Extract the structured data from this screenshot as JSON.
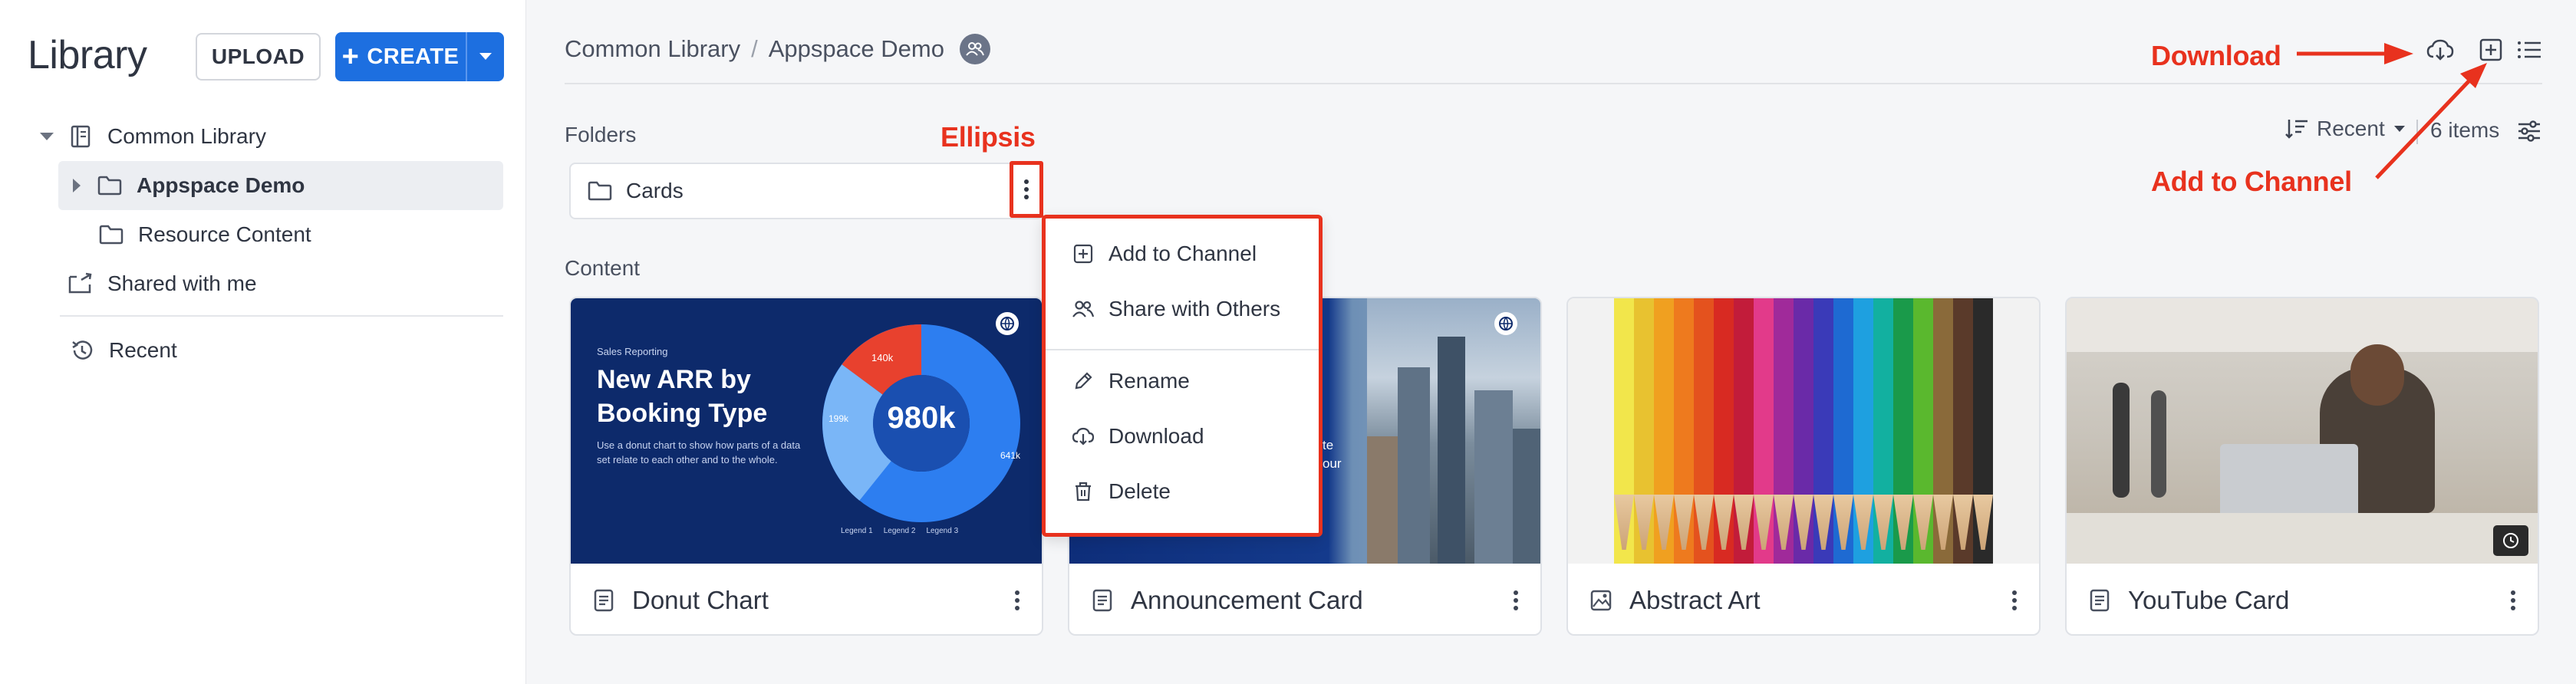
{
  "sidebar": {
    "title": "Library",
    "upload_label": "UPLOAD",
    "create_label": "CREATE",
    "tree": [
      {
        "label": "Common Library"
      },
      {
        "label": "Appspace Demo"
      },
      {
        "label": "Resource Content"
      },
      {
        "label": "Shared with me"
      },
      {
        "label": "Recent"
      }
    ]
  },
  "header": {
    "breadcrumb": [
      "Common Library",
      "/",
      "Appspace Demo"
    ]
  },
  "toolbar": {
    "sort_label": "Recent",
    "items_count": "6 items",
    "icons": [
      "download-icon",
      "add-to-channel-icon",
      "list-view-icon",
      "filter-settings-icon"
    ]
  },
  "folders": {
    "label": "Folders",
    "items": [
      {
        "name": "Cards"
      }
    ]
  },
  "context_menu": {
    "items": [
      {
        "label": "Add to Channel",
        "icon": "add-box-icon"
      },
      {
        "label": "Share with Others",
        "icon": "people-icon"
      },
      {
        "label": "Rename",
        "icon": "pencil-icon"
      },
      {
        "label": "Download",
        "icon": "cloud-download-icon"
      },
      {
        "label": "Delete",
        "icon": "trash-icon"
      }
    ]
  },
  "content": {
    "label": "Content",
    "cards": [
      {
        "title": "Donut Chart",
        "thumb": {
          "kicker": "Sales Reporting",
          "heading_line1": "New ARR by",
          "heading_line2": "Booking Type",
          "body": "Use a donut chart to show how parts of a data set relate to each other and to the whole.",
          "center_value": "980k",
          "slice_labels": [
            "140k",
            "199k",
            "641k"
          ],
          "legend": [
            "Legend 1",
            "Legend 2",
            "Legend 3"
          ]
        }
      },
      {
        "title": "Announcement Card",
        "thumb": {
          "fragment_line1": "te",
          "fragment_line2": "our"
        }
      },
      {
        "title": "Abstract Art"
      },
      {
        "title": "YouTube Card"
      }
    ]
  },
  "annotations": {
    "download": "Download",
    "ellipsis": "Ellipsis",
    "add_to_channel": "Add to Channel"
  },
  "colors": {
    "accent": "#1d6fe0",
    "annotation_red": "#e8321e",
    "donut_dark_blue": "#0d2a6b"
  }
}
